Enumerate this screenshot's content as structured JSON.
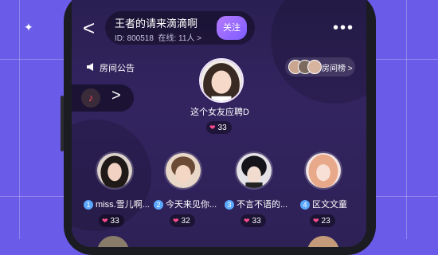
{
  "room": {
    "title": "王者的请来滴滴啊",
    "id_text": "ID: 800518",
    "online_text": "在线: 11人",
    "chevron": ">",
    "follow_label": "关注"
  },
  "header": {
    "back_icon": "<",
    "more_icon": "•••"
  },
  "announcement": {
    "icon": "megaphone-icon",
    "label": "房间公告"
  },
  "ranking": {
    "label": "房间榜",
    "chevron": ">"
  },
  "music": {
    "icon": "music-note-icon",
    "arrow": ">"
  },
  "host": {
    "name": "这个女友应聘D",
    "hearts": "33"
  },
  "seats": [
    {
      "num": "1",
      "name": "miss.雪儿啊...",
      "hearts": "33"
    },
    {
      "num": "2",
      "name": "今天来见你...",
      "hearts": "32"
    },
    {
      "num": "3",
      "name": "不言不语的...",
      "hearts": "33"
    },
    {
      "num": "4",
      "name": "区文文童",
      "hearts": "23"
    }
  ],
  "colors": {
    "background": "#6a5ce8",
    "screen": "#2d2156",
    "accent": "#8a62ff",
    "heart": "#ff4d8d",
    "seat_number": "#5aa7ff"
  }
}
